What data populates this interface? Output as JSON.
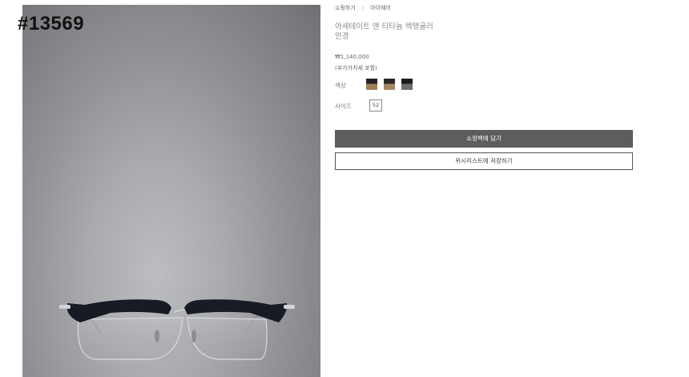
{
  "id_tag": "#13569",
  "breadcrumb": {
    "items": [
      "쇼핑하기",
      "아이웨어"
    ],
    "separator": "/"
  },
  "product": {
    "title": "아세테이트 앤 티타늄 렉탱귤러 안경",
    "price": "₩1,140,000",
    "vat_note": "(부가가치세 포함)",
    "color_label": "색상",
    "swatches": [
      {
        "name": "black-tan",
        "colors": [
          "#222222",
          "#a38056"
        ]
      },
      {
        "name": "black-gold",
        "colors": [
          "#2a2a2a",
          "#a38a62"
        ]
      },
      {
        "name": "black-grey",
        "colors": [
          "#1c1c1c",
          "#6e6e6e"
        ]
      }
    ],
    "size_label": "사이즈",
    "size_value": "52"
  },
  "actions": {
    "add_to_cart": "쇼핑백에 담기",
    "save_to_wishlist": "위시리스트에 저장하기"
  },
  "image": {
    "subject": "eyeglasses",
    "colors": {
      "frame": "#161b24",
      "metal": "#d2d3d6"
    }
  }
}
